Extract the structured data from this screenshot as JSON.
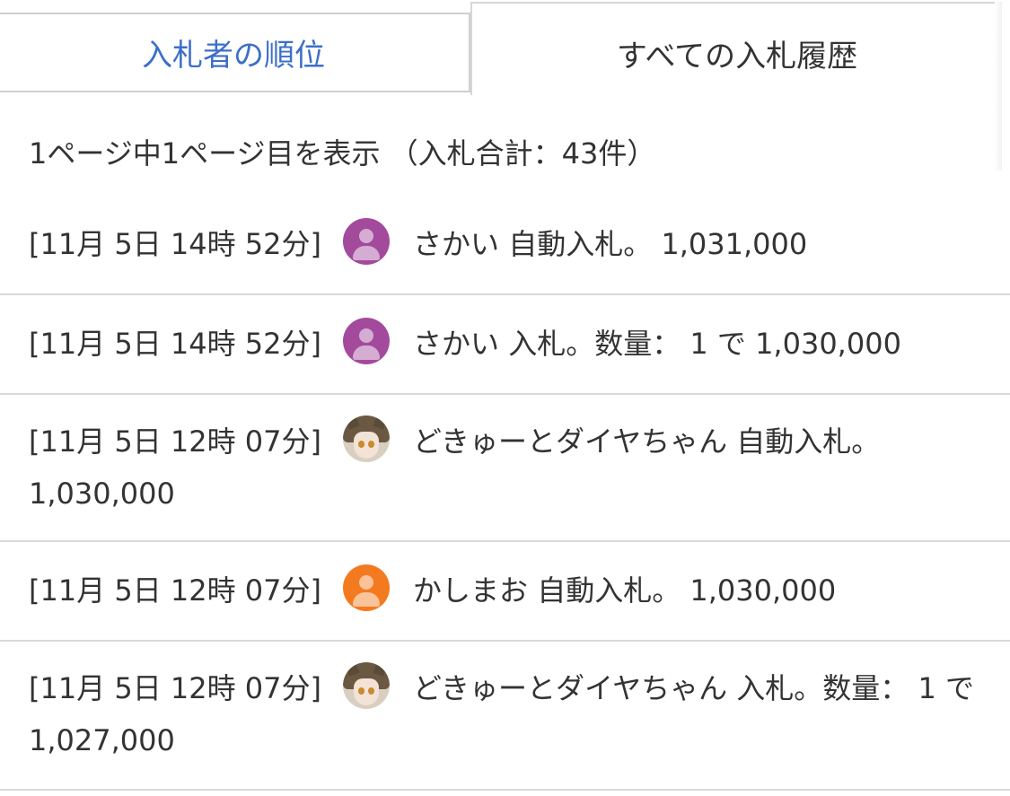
{
  "tabs": {
    "ranking": "入札者の順位",
    "history": "すべての入札履歴"
  },
  "summary": "1ページ中1ページ目を表示 （入札合計：43件）",
  "bids": [
    {
      "time": "[11月 5日 14時 52分]",
      "avatar": "user-silhouette-icon",
      "avatar_color": "#a34a9d",
      "text": "さかい 自動入札。 1,031,000"
    },
    {
      "time": "[11月 5日 14時 52分]",
      "avatar": "user-silhouette-icon",
      "avatar_color": "#a34a9d",
      "text": "さかい 入札。数量： 1 で 1,030,000"
    },
    {
      "time": "[11月 5日 12時 07分]",
      "avatar": "anime-character-avatar",
      "text": "どきゅーとダイヤちゃん 自動入札。 1,030,000"
    },
    {
      "time": "[11月 5日 12時 07分]",
      "avatar": "user-silhouette-icon",
      "avatar_color": "#f47a20",
      "text": "かしまお 自動入札。 1,030,000"
    },
    {
      "time": "[11月 5日 12時 07分]",
      "avatar": "anime-character-avatar",
      "text": "どきゅーとダイヤちゃん 入札。数量： 1 で 1,027,000"
    }
  ],
  "colors": {
    "link_blue": "#3c6fc9",
    "text": "#333333",
    "divider": "#d9d9d9"
  }
}
